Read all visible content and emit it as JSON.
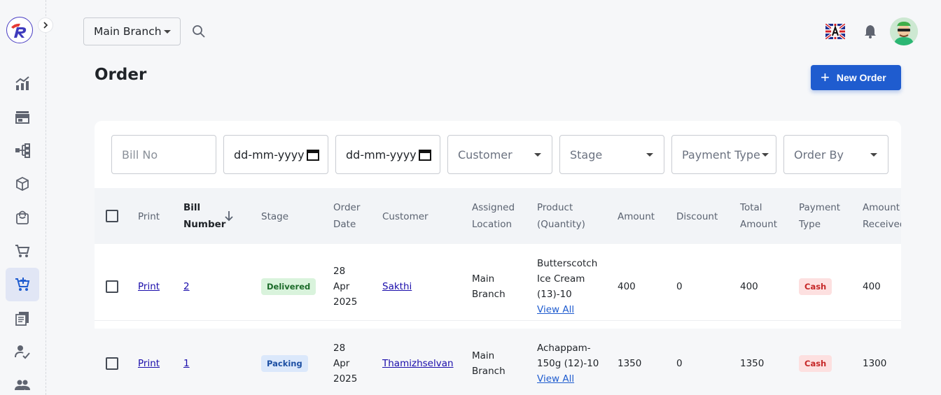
{
  "topbar": {
    "branch": "Main Branch"
  },
  "page": {
    "title": "Order",
    "new_order_label": "New Order"
  },
  "filters": {
    "bill_no_placeholder": "Bill No",
    "date_from": "dd-mm-yyyy",
    "date_to": "dd-mm-yyyy",
    "customer": "Customer",
    "stage": "Stage",
    "payment_type": "Payment Type",
    "order_by": "Order By"
  },
  "table": {
    "headers": {
      "print": "Print",
      "bill_number_1": "Bill",
      "bill_number_2": "Number",
      "stage": "Stage",
      "order_date_1": "Order",
      "order_date_2": "Date",
      "customer": "Customer",
      "assigned_location_1": "Assigned",
      "assigned_location_2": "Location",
      "product_1": "Product",
      "product_2": "(Quantity)",
      "amount": "Amount",
      "discount": "Discount",
      "total_amount_1": "Total",
      "total_amount_2": "Amount",
      "payment_type_1": "Payment",
      "payment_type_2": "Type",
      "amount_received_1": "Amount",
      "amount_received_2": "Received"
    },
    "rows": [
      {
        "print": "Print",
        "bill_number": "2",
        "stage": "Delivered",
        "date_1": "28",
        "date_2": "Apr",
        "date_3": "2025",
        "customer": "Sakthi",
        "location_1": "Main",
        "location_2": "Branch",
        "product_1": "Butterscotch",
        "product_2": "Ice Cream",
        "product_3": "(13)-10",
        "view_all": "View All",
        "amount": "400",
        "discount": "0",
        "total": "400",
        "payment": "Cash",
        "received": "400"
      },
      {
        "print": "Print",
        "bill_number": "1",
        "stage": "Packing",
        "date_1": "28",
        "date_2": "Apr",
        "date_3": "2025",
        "customer": "Thamizhselvan",
        "location_1": "Main",
        "location_2": "Branch",
        "product_1": "Achappam-",
        "product_2": "150g (12)-10",
        "view_all": "View All",
        "amount": "1350",
        "discount": "0",
        "total": "1350",
        "payment": "Cash",
        "received": "1300"
      }
    ]
  },
  "nav_icons": [
    "chart-icon",
    "store-icon",
    "hierarchy-icon",
    "box-icon",
    "bag-icon",
    "cart-icon",
    "cart-plus-icon",
    "receipt-icon",
    "user-check-icon",
    "users-icon"
  ],
  "colors": {
    "primary": "#1f5ccf",
    "active_nav_bg": "#e1e6f5",
    "delivered_bg": "#d9f3dc",
    "packing_bg": "#dbe8fb",
    "cash_bg": "#fde0e0"
  }
}
